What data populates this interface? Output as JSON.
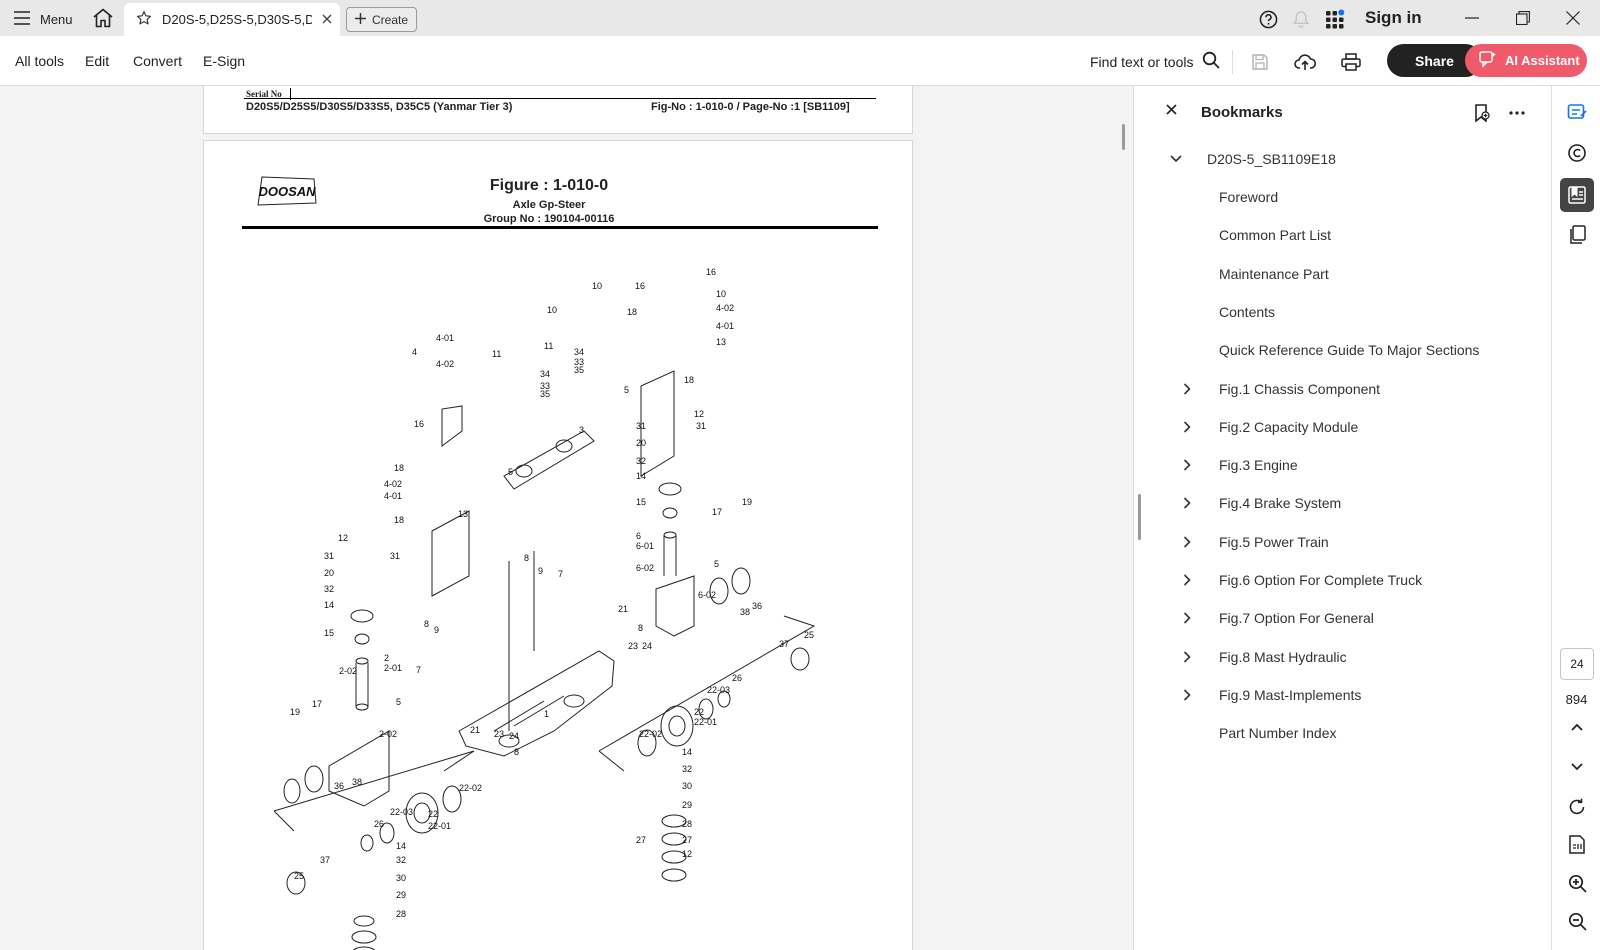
{
  "titlebar": {
    "menu_label": "Menu",
    "tab_title": "D20S-5,D25S-5,D30S-5,D...",
    "create_label": "Create",
    "signin_label": "Sign in"
  },
  "toolbar": {
    "menu_items": [
      "All tools",
      "Edit",
      "Convert",
      "E-Sign"
    ],
    "find_label": "Find text or tools",
    "share_label": "Share",
    "ai_label": "AI Assistant"
  },
  "document": {
    "prev_page": {
      "serial_label": "Serial No",
      "model_text": "D20S5/D25S5/D30S5/D33S5, D35C5 (Yanmar  Tier 3)",
      "fig_ref": "Fig-No : 1-010-0 / Page-No :1 [SB1109]"
    },
    "page": {
      "logo_text": "DOOSAN",
      "figure_title": "Figure : 1-010-0",
      "figure_subtitle": "Axle Gp-Steer",
      "group_no": "Group No :  190104-00116"
    }
  },
  "bookmarks": {
    "title": "Bookmarks",
    "root": "D20S-5_SB1109E18",
    "items": [
      {
        "label": "Foreword",
        "expandable": false
      },
      {
        "label": "Common Part List",
        "expandable": false
      },
      {
        "label": "Maintenance Part",
        "expandable": false
      },
      {
        "label": "Contents",
        "expandable": false
      },
      {
        "label": "Quick Reference Guide To Major Sections",
        "expandable": false
      },
      {
        "label": "Fig.1 Chassis Component",
        "expandable": true
      },
      {
        "label": "Fig.2 Capacity Module",
        "expandable": true
      },
      {
        "label": "Fig.3 Engine",
        "expandable": true
      },
      {
        "label": "Fig.4 Brake System",
        "expandable": true
      },
      {
        "label": "Fig.5 Power Train",
        "expandable": true
      },
      {
        "label": "Fig.6 Option For Complete Truck",
        "expandable": true
      },
      {
        "label": "Fig.7 Option For General",
        "expandable": true
      },
      {
        "label": "Fig.8 Mast Hydraulic",
        "expandable": true
      },
      {
        "label": "Fig.9 Mast-Implements",
        "expandable": true
      },
      {
        "label": "Part Number Index",
        "expandable": false
      }
    ]
  },
  "navigation": {
    "current_page": "24",
    "total_pages": "894"
  },
  "drawing_labels": [
    "16",
    "10",
    "10",
    "16",
    "18",
    "10",
    "4-02",
    "4-01",
    "13",
    "4-01",
    "4",
    "4-02",
    "11",
    "11",
    "34",
    "33",
    "35",
    "34",
    "33",
    "35",
    "5",
    "18",
    "3",
    "16",
    "12",
    "31",
    "31",
    "20",
    "32",
    "14",
    "18",
    "5",
    "4-02",
    "4-01",
    "18",
    "13",
    "15",
    "17",
    "19",
    "6",
    "6-01",
    "6-02",
    "5",
    "6-02",
    "12",
    "31",
    "31",
    "20",
    "32",
    "14",
    "8",
    "9",
    "7",
    "21",
    "8",
    "38",
    "36",
    "37",
    "25",
    "15",
    "2",
    "2-01",
    "2-02",
    "8",
    "9",
    "7",
    "23",
    "24",
    "26",
    "22-03",
    "22",
    "22-01",
    "22-02",
    "5",
    "19",
    "17",
    "2-02",
    "21",
    "23",
    "24",
    "8",
    "1",
    "14",
    "32",
    "30",
    "29",
    "28",
    "27",
    "27",
    "12",
    "36",
    "38",
    "26",
    "22-03",
    "22",
    "22-01",
    "22-02",
    "37",
    "25",
    "14",
    "32",
    "30",
    "29",
    "28"
  ],
  "colors": {
    "titlebar_bg": "#e8e8e8",
    "share_bg": "#222222",
    "ai_bg": "#ef5b6b",
    "accent_blue": "#1473e6",
    "doc_bg": "#f3f3f3"
  }
}
